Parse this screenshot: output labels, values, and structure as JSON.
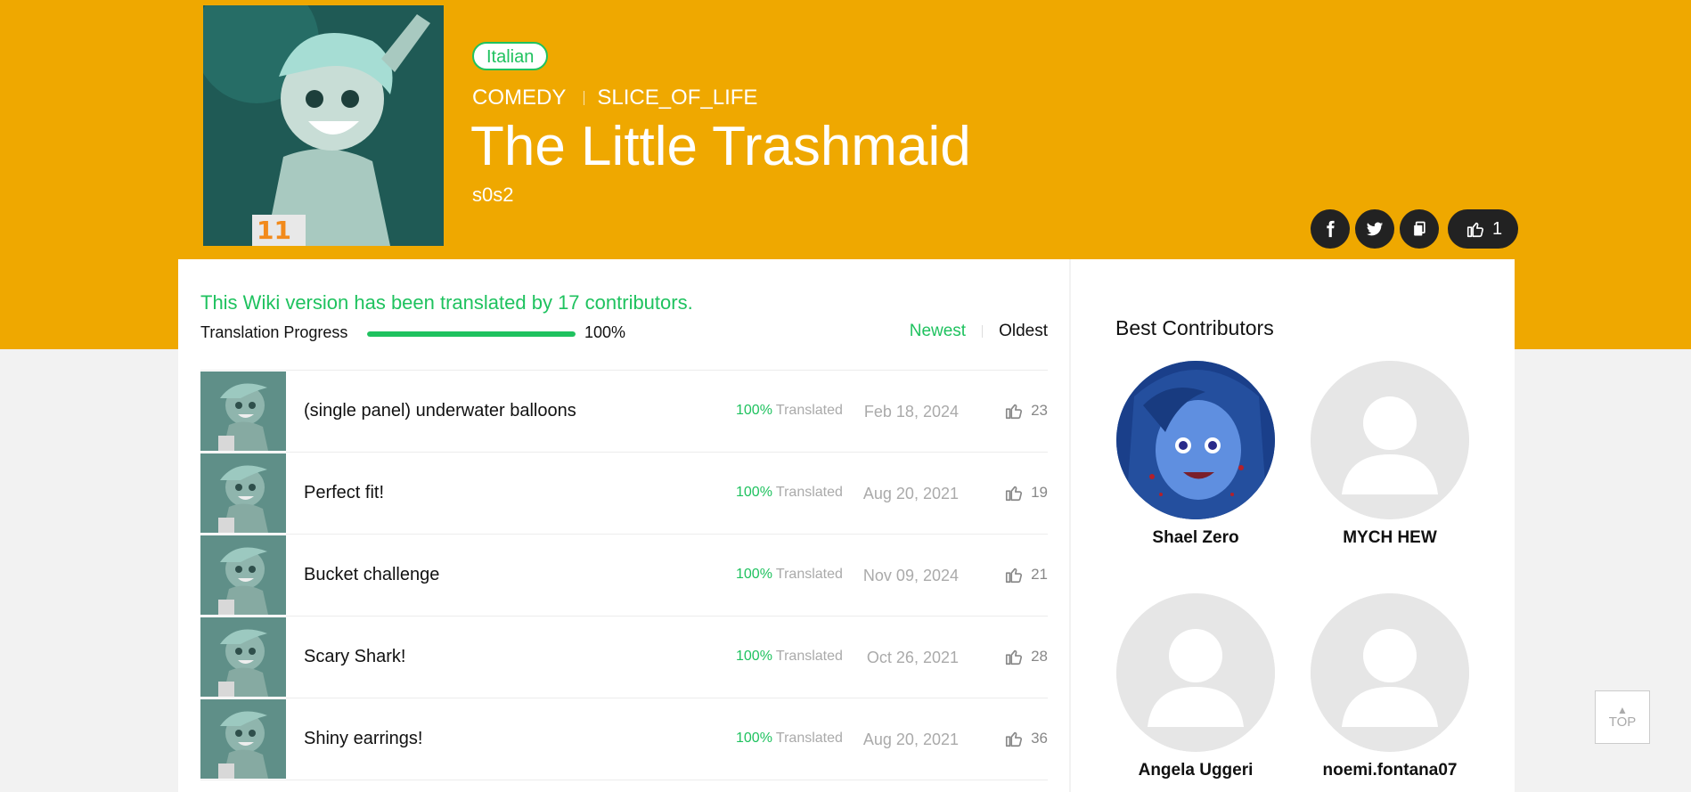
{
  "series": {
    "language": "Italian",
    "genres": [
      "COMEDY",
      "SLICE_OF_LIFE"
    ],
    "title": "The Little Trashmaid",
    "author": "s0s2",
    "like_count": "1"
  },
  "share_icons": [
    "facebook-icon",
    "twitter-icon",
    "copy-link-icon"
  ],
  "translation": {
    "note": "This Wiki version has been translated by 17 contributors.",
    "progress_label": "Translation Progress",
    "progress_value": "100%",
    "progress_fraction": 1.0
  },
  "sort": {
    "newest": "Newest",
    "oldest": "Oldest"
  },
  "episodes": [
    {
      "title": "(single panel) underwater balloons",
      "percent": "100%",
      "percent_label": "Translated",
      "date": "Feb 18, 2024",
      "likes": "23"
    },
    {
      "title": "Perfect fit!",
      "percent": "100%",
      "percent_label": "Translated",
      "date": "Aug 20, 2021",
      "likes": "19"
    },
    {
      "title": "Bucket challenge",
      "percent": "100%",
      "percent_label": "Translated",
      "date": "Nov 09, 2024",
      "likes": "21"
    },
    {
      "title": "Scary Shark!",
      "percent": "100%",
      "percent_label": "Translated",
      "date": "Oct 26, 2021",
      "likes": "28"
    },
    {
      "title": "Shiny earrings!",
      "percent": "100%",
      "percent_label": "Translated",
      "date": "Aug 20, 2021",
      "likes": "36"
    }
  ],
  "contributors": {
    "title": "Best Contributors",
    "items": [
      {
        "name": "Shael Zero"
      },
      {
        "name": "MYCH HEW"
      },
      {
        "name": "Angela Uggeri"
      },
      {
        "name": "noemi.fontana07"
      }
    ]
  },
  "top_button": "TOP",
  "colors": {
    "header": "#efa800",
    "accent": "#1fc25f",
    "background": "#f2f2f2"
  }
}
